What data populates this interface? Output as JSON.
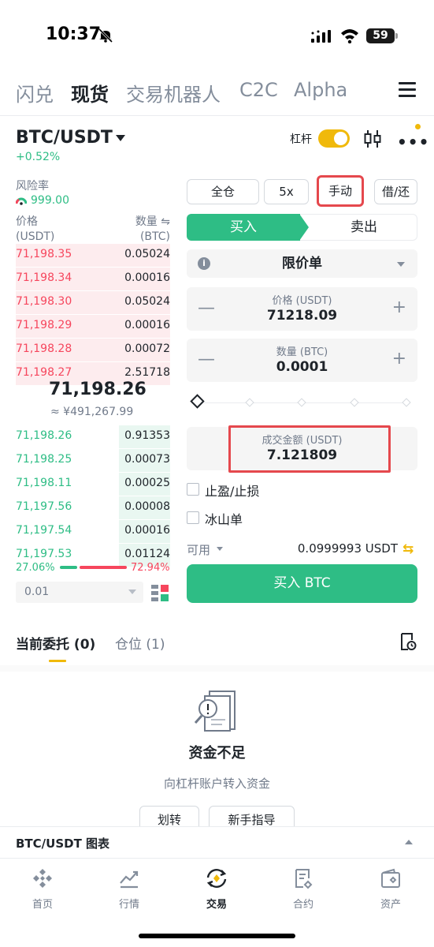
{
  "status_bar": {
    "time": "10:37",
    "battery": "59"
  },
  "top_tabs": [
    "闪兑",
    "现货",
    "交易机器人",
    "C2C",
    "Alpha"
  ],
  "pair": {
    "name": "BTC/USDT",
    "change": "+0.52%",
    "leverage_label": "杠杆"
  },
  "risk": {
    "label": "风险率",
    "value": "999.00"
  },
  "orderbook": {
    "price_header": "价格",
    "price_unit": "(USDT)",
    "qty_header": "数量 ⇋",
    "qty_unit": "(BTC)",
    "asks": [
      {
        "price": "71,198.35",
        "qty": "0.05024",
        "depth": 0.4
      },
      {
        "price": "71,198.34",
        "qty": "0.00016",
        "depth": 0.02
      },
      {
        "price": "71,198.30",
        "qty": "0.05024",
        "depth": 0.4
      },
      {
        "price": "71,198.29",
        "qty": "0.00016",
        "depth": 0.02
      },
      {
        "price": "71,198.28",
        "qty": "0.00072",
        "depth": 0.05
      },
      {
        "price": "71,198.27",
        "qty": "2.51718",
        "depth": 1.0
      }
    ],
    "last_price": "71,198.26",
    "last_price_cny": "≈ ¥491,267.99",
    "bids": [
      {
        "price": "71,198.26",
        "qty": "0.91353",
        "depth": 0.33
      },
      {
        "price": "71,198.25",
        "qty": "0.00073",
        "depth": 0.33
      },
      {
        "price": "71,198.11",
        "qty": "0.00025",
        "depth": 0.33
      },
      {
        "price": "71,197.56",
        "qty": "0.00008",
        "depth": 0.33
      },
      {
        "price": "71,197.54",
        "qty": "0.00016",
        "depth": 0.33
      },
      {
        "price": "71,197.53",
        "qty": "0.01124",
        "depth": 0.33
      }
    ],
    "buy_ratio": "27.06%",
    "sell_ratio": "72.94%",
    "precision": "0.01"
  },
  "order_form": {
    "margin_mode": "全仓",
    "leverage": "5x",
    "borrow_mode": "手动",
    "borrow_repay": "借/还",
    "buy_tab": "买入",
    "sell_tab": "卖出",
    "order_type": "限价单",
    "price_label": "价格 (USDT)",
    "price_value": "71218.09",
    "amount_label": "数量 (BTC)",
    "amount_value": "0.0001",
    "total_label": "成交金额 (USDT)",
    "total_value": "7.121809",
    "tp_sl": "止盈/止损",
    "iceberg": "冰山单",
    "available_label": "可用",
    "available_value": "0.0999993 USDT",
    "submit": "买入 BTC"
  },
  "orders_tabs": {
    "open": "当前委托 (0)",
    "positions": "仓位 (1)"
  },
  "empty_state": {
    "title": "资金不足",
    "subtitle": "向杠杆账户转入资金",
    "transfer": "划转",
    "guide": "新手指导"
  },
  "chart_bar": {
    "label": "BTC/USDT 图表"
  },
  "bottom_nav": [
    "首页",
    "行情",
    "交易",
    "合约",
    "资产"
  ],
  "colors": {
    "green": "#2ebd85",
    "red": "#f6465d",
    "accent": "#f0b90b"
  }
}
